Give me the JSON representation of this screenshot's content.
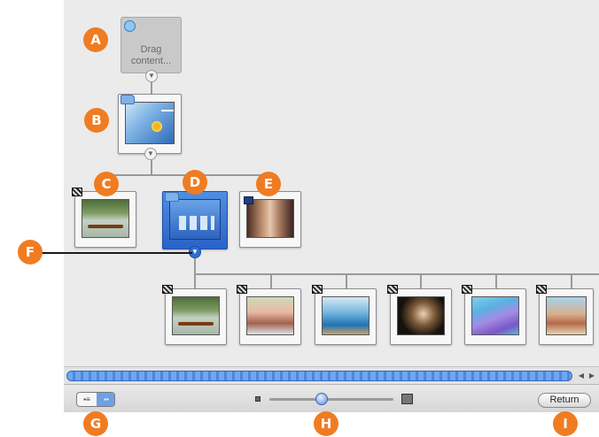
{
  "callouts": [
    "A",
    "B",
    "C",
    "D",
    "E",
    "F",
    "G",
    "H",
    "I"
  ],
  "drop_node": {
    "text_line1": "Drag",
    "text_line2": "content..."
  },
  "toolbar": {
    "return_label": "Return",
    "view_toggle": {
      "left_icon": "list-view-icon",
      "right_icon": "map-view-icon"
    }
  },
  "scrollbar": {
    "left_arrow": "◀",
    "right_arrow": "▶"
  },
  "icons": {
    "disclosure": "▼"
  },
  "colors": {
    "canvas_bg": "#ebebeb",
    "callout": "#f07c22",
    "selected_node": "#2a62c7",
    "scroll_thumb": "#4d86dc"
  }
}
